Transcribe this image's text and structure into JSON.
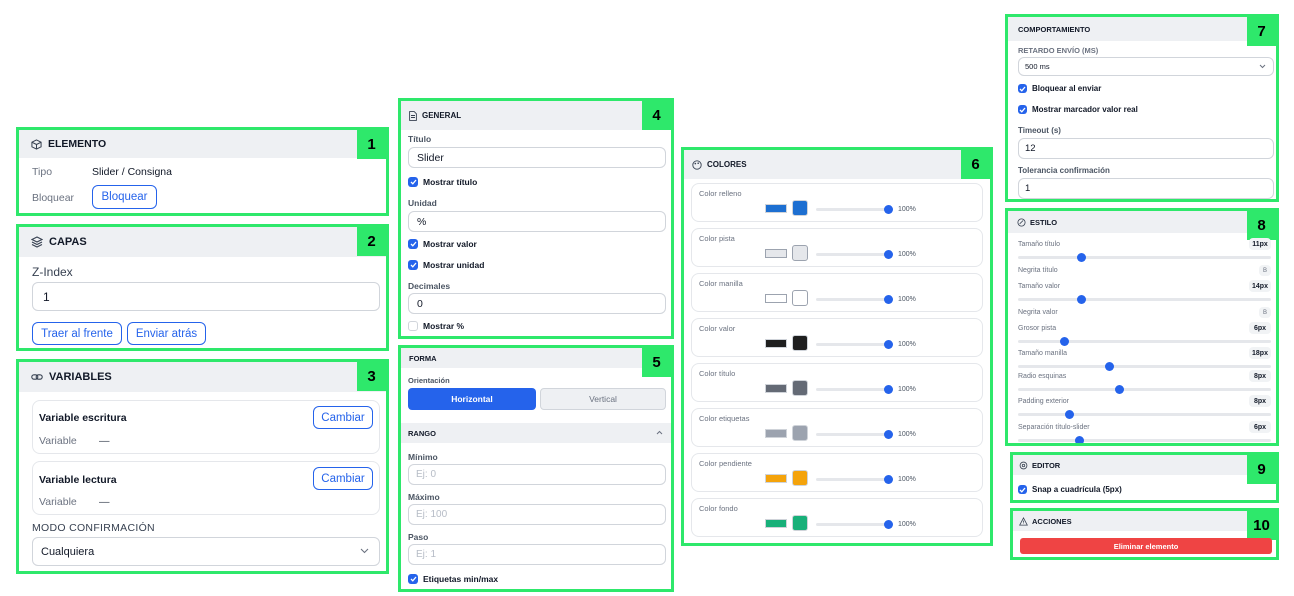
{
  "elemento": {
    "title": "ELEMENTO",
    "num": "1",
    "tipo_label": "Tipo",
    "tipo_value": "Slider / Consigna",
    "bloquear_label": "Bloquear",
    "bloquear_button": "Bloquear"
  },
  "capas": {
    "title": "CAPAS",
    "num": "2",
    "zindex_label": "Z-Index",
    "zindex_value": "1",
    "front_button": "Traer al frente",
    "back_button": "Enviar atrás"
  },
  "variables": {
    "title": "VARIABLES",
    "num": "3",
    "write": {
      "title": "Variable escritura",
      "button": "Cambiar",
      "label": "Variable",
      "value": "—"
    },
    "read": {
      "title": "Variable lectura",
      "button": "Cambiar",
      "label": "Variable",
      "value": "—"
    },
    "mode_label": "MODO CONFIRMACIÓN",
    "mode_value": "Cualquiera"
  },
  "general": {
    "title": "GENERAL",
    "num": "4",
    "titulo_label": "Título",
    "titulo_value": "Slider",
    "mostrar_titulo": "Mostrar título",
    "unidad_label": "Unidad",
    "unidad_value": "%",
    "mostrar_valor": "Mostrar valor",
    "mostrar_unidad": "Mostrar unidad",
    "decimales_label": "Decimales",
    "decimales_value": "0",
    "mostrar_pct": "Mostrar %",
    "checks": {
      "titulo": true,
      "valor": true,
      "unidad": true,
      "pct": false
    }
  },
  "forma": {
    "title": "FORMA",
    "num": "5",
    "orient_label": "Orientación",
    "horizontal": "Horizontal",
    "vertical": "Vertical",
    "rango_title": "RANGO",
    "min_label": "Mínimo",
    "min_placeholder": "Ej: 0",
    "max_label": "Máximo",
    "max_placeholder": "Ej: 100",
    "paso_label": "Paso",
    "paso_placeholder": "Ej: 1",
    "etiquetas": "Etiquetas min/max"
  },
  "colores": {
    "title": "COLORES",
    "num": "6",
    "items": [
      {
        "label": "Color relleno",
        "color": "#1d6fd1",
        "pct": "100%",
        "level": 1.0
      },
      {
        "label": "Color pista",
        "color": "#e5e7eb",
        "pct": "100%",
        "level": 1.0
      },
      {
        "label": "Color manilla",
        "color": "#ffffff",
        "pct": "100%",
        "level": 1.0
      },
      {
        "label": "Color valor",
        "color": "#1f1f1f",
        "pct": "100%",
        "level": 1.0
      },
      {
        "label": "Color título",
        "color": "#646a75",
        "pct": "100%",
        "level": 1.0
      },
      {
        "label": "Color etiquetas",
        "color": "#9ca3af",
        "pct": "100%",
        "level": 1.0
      },
      {
        "label": "Color pendiente",
        "color": "#f4a30b",
        "pct": "100%",
        "level": 1.0
      },
      {
        "label": "Color fondo",
        "color": "#18b079",
        "pct": "100%",
        "level": 1.0
      }
    ]
  },
  "comportamiento": {
    "title": "COMPORTAMIENTO",
    "num": "7",
    "retardo_label": "RETARDO ENVÍO (MS)",
    "retardo_value": "500 ms",
    "bloquear": "Bloquear al enviar",
    "marcador": "Mostrar marcador valor real",
    "timeout_label": "Timeout (s)",
    "timeout_value": "12",
    "tolerancia_label": "Tolerancia confirmación",
    "tolerancia_value": "1"
  },
  "estilo": {
    "title": "ESTILO",
    "num": "8",
    "rows": [
      {
        "label": "Tamaño título",
        "value": "11px",
        "slider": 0.25
      },
      {
        "label": "Negrita título",
        "value": "B"
      },
      {
        "label": "Tamaño valor",
        "value": "14px",
        "slider": 0.25
      },
      {
        "label": "Negrita valor",
        "value": "B"
      },
      {
        "label": "Grosor pista",
        "value": "6px",
        "slider": 0.18
      },
      {
        "label": "Tamaño manilla",
        "value": "18px",
        "slider": 0.36
      },
      {
        "label": "Radio esquinas",
        "value": "8px",
        "slider": 0.4
      },
      {
        "label": "Padding exterior",
        "value": "8px",
        "slider": 0.2
      },
      {
        "label": "Separación título-slider",
        "value": "6px",
        "slider": 0.24
      }
    ]
  },
  "editor": {
    "title": "EDITOR",
    "num": "9",
    "snap": "Snap a cuadrícula (5px)"
  },
  "acciones": {
    "title": "ACCIONES",
    "num": "10",
    "delete": "Eliminar elemento"
  },
  "accent": "#2563eb",
  "panel_border": "#2ee86b",
  "danger": "#ef4444"
}
